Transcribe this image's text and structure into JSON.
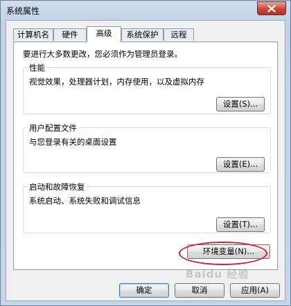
{
  "window": {
    "title": "系统属性",
    "close_label": "close"
  },
  "tabs": [
    {
      "label": "计算机名",
      "active": false
    },
    {
      "label": "硬件",
      "active": false
    },
    {
      "label": "高级",
      "active": true
    },
    {
      "label": "系统保护",
      "active": false
    },
    {
      "label": "远程",
      "active": false
    }
  ],
  "advanced": {
    "intro": "要进行大多数更改，您必须作为管理员登录。",
    "performance": {
      "title": "性能",
      "description": "视觉效果，处理器计划，内存使用，以及虚拟内存",
      "button": "设置(S)..."
    },
    "user_profiles": {
      "title": "用户配置文件",
      "description": "与您登录有关的桌面设置",
      "button": "设置(E)..."
    },
    "startup_recovery": {
      "title": "启动和故障恢复",
      "description": "系统启动、系统失败和调试信息",
      "button": "设置(T)..."
    },
    "env_button": "环境变量(N)..."
  },
  "footer": {
    "ok": "确定",
    "cancel": "取消",
    "apply": "应用(A)"
  },
  "annotation": {
    "ellipse_color": "#d0202a"
  },
  "watermark": "Baidu 经验"
}
